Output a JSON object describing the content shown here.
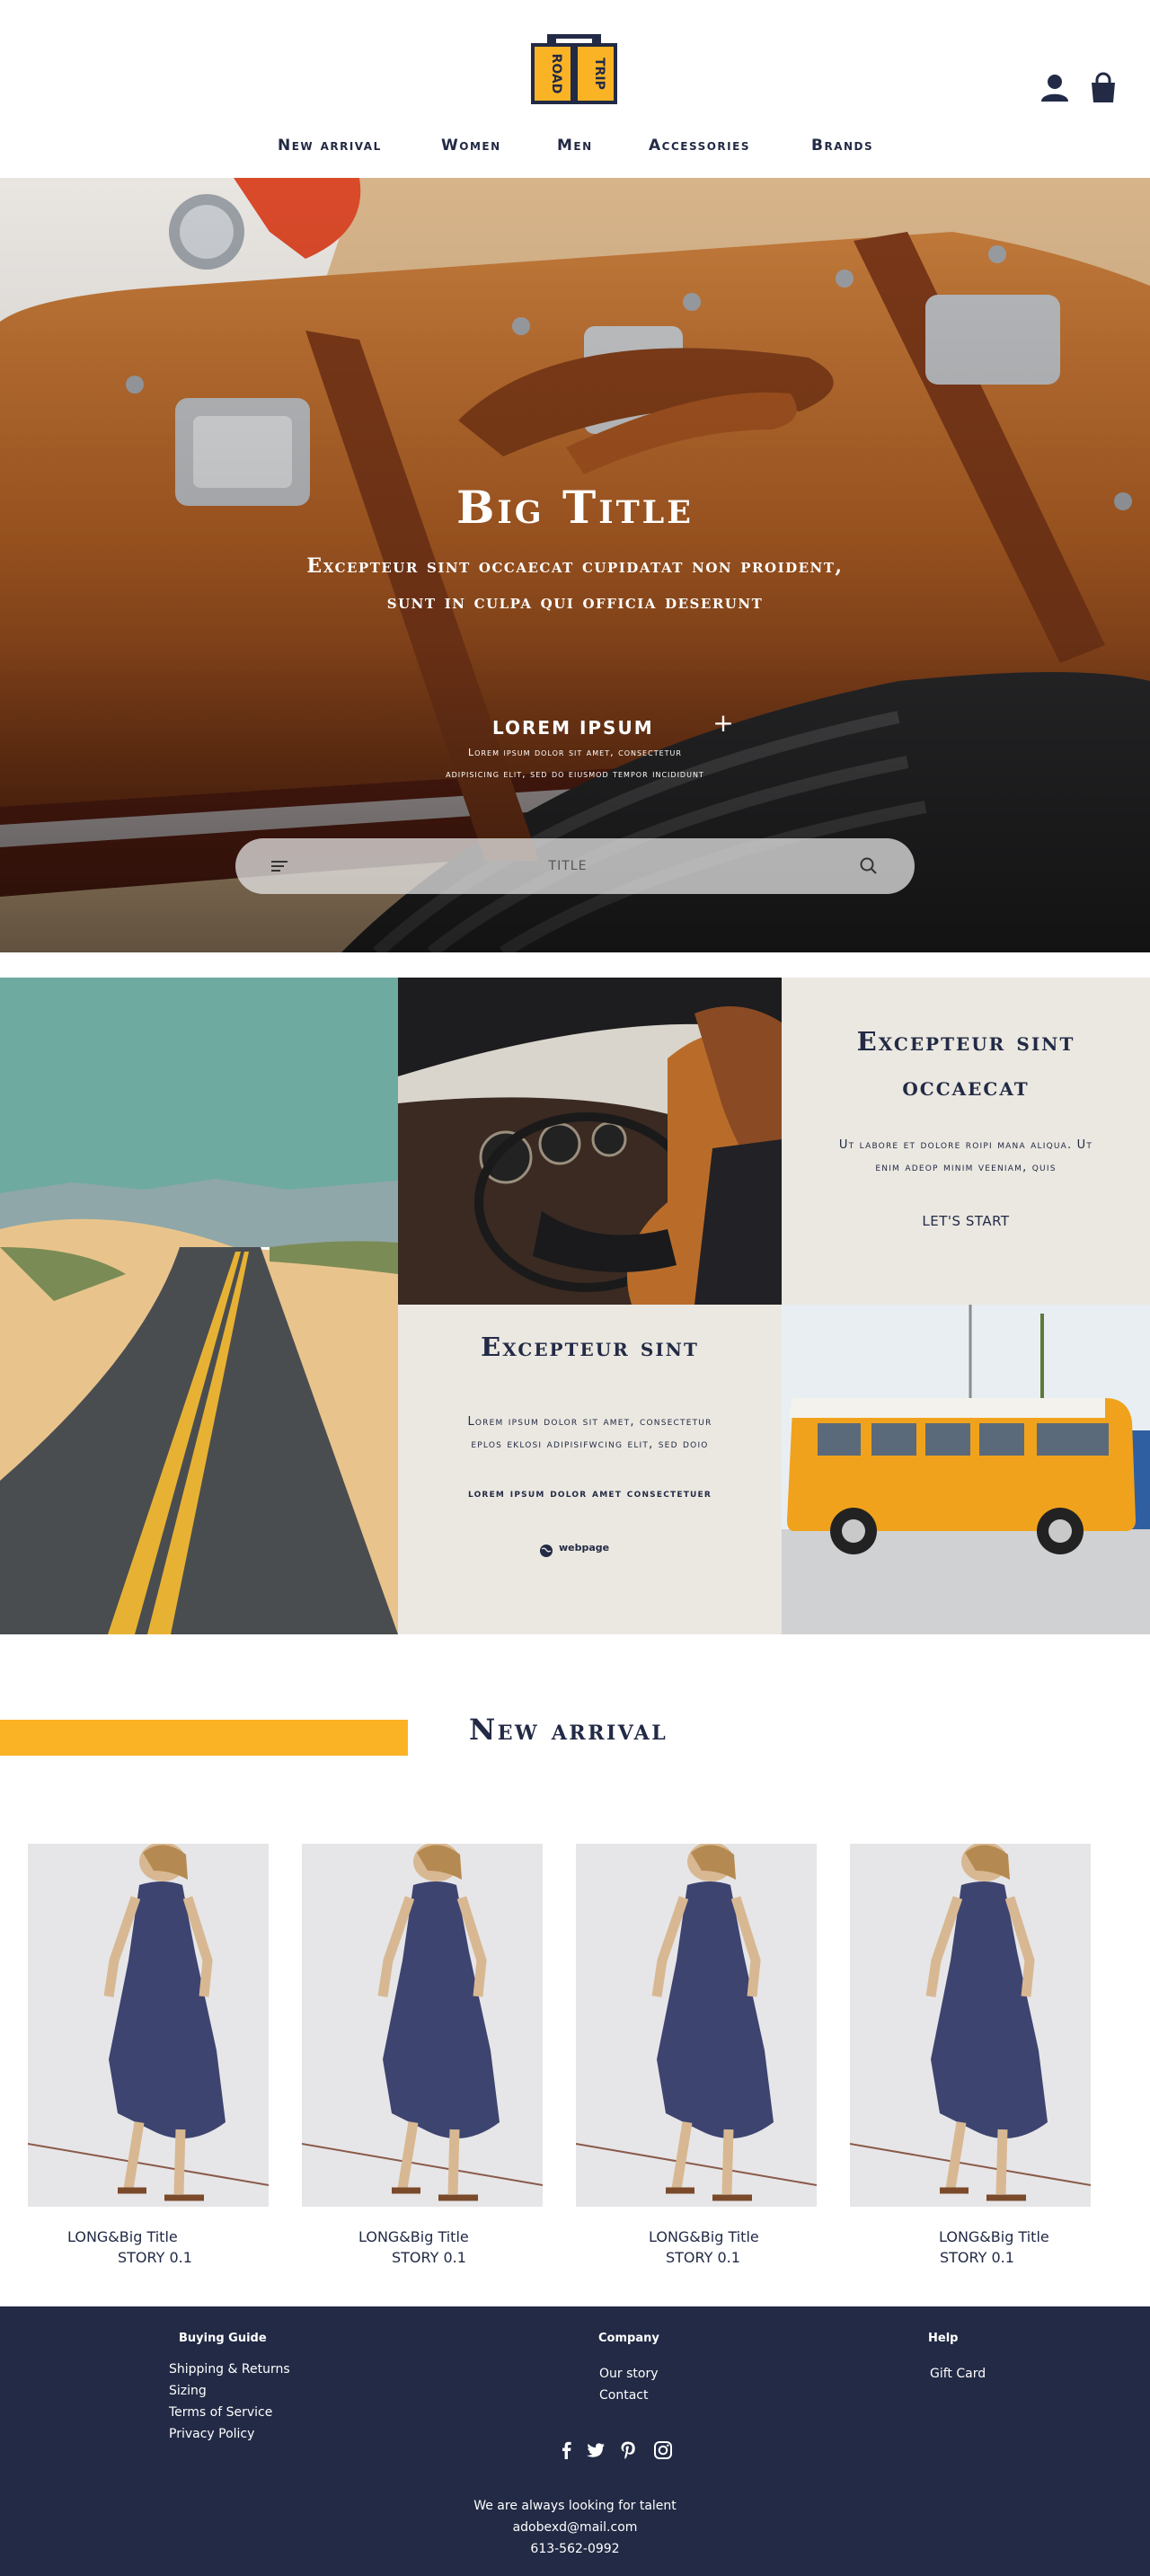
{
  "logo": {
    "text_top": "ROAD",
    "text_bottom": "TRIP"
  },
  "header_icons": [
    "user-icon",
    "shopping-bag-icon"
  ],
  "nav": [
    "New arrival",
    "Women",
    "Men",
    "Accessories",
    "Brands"
  ],
  "hero": {
    "title": "Big Title",
    "subtitle_line1": "Excepteur sint occaecat cupidatat non proident,",
    "subtitle_line2": "sunt in culpa qui officia deserunt",
    "small_title": "LOREM IPSUM",
    "small_text_line1": "Lorem ipsum dolor sit amet, consectetur",
    "small_text_line2": "adipisicing elit, sed do eiusmod tempor incididunt",
    "search_placeholder": "TITLE"
  },
  "promo1": {
    "title_line1": "Excepteur sint",
    "title_line2": "occaecat",
    "text_line1": "Ut labore et dolore roipi mana aliqua. Ut",
    "text_line2": "enim adeop minim veeniam, quis",
    "button": "LET'S START"
  },
  "promo2": {
    "title": "Excepteur sint",
    "text_line1": "Lorem ipsum dolor sit amet, consectetur",
    "text_line2": "eplos eklosi adipisifwcing elit, sed doio",
    "subline": "lorem ipsum dolor amet consectetuer",
    "link": "webpage"
  },
  "new_arrival": {
    "title": "New arrival",
    "products": [
      {
        "title": "LONG&Big Title",
        "story": "STORY 0.1"
      },
      {
        "title": "LONG&Big Title",
        "story": "STORY 0.1"
      },
      {
        "title": "LONG&Big Title",
        "story": "STORY 0.1"
      },
      {
        "title": "LONG&Big Title",
        "story": "STORY 0.1"
      }
    ]
  },
  "footer": {
    "buying_guide": {
      "heading": "Buying Guide",
      "links": [
        "Shipping & Returns",
        "Sizing",
        "Terms of Service",
        "Privacy Policy"
      ]
    },
    "company": {
      "heading": "Company",
      "links": [
        "Our story",
        "Contact"
      ]
    },
    "help": {
      "heading": "Help",
      "links": [
        "Gift Card"
      ]
    },
    "social": [
      "facebook-icon",
      "twitter-icon",
      "pinterest-icon",
      "instagram-icon"
    ],
    "tagline": "We are always looking for talent",
    "email": "adobexd@mail.com",
    "phone": "613-562-0992"
  },
  "colors": {
    "navy": "#222a45",
    "accent": "#fbb326",
    "beige": "#ebe8e1"
  }
}
